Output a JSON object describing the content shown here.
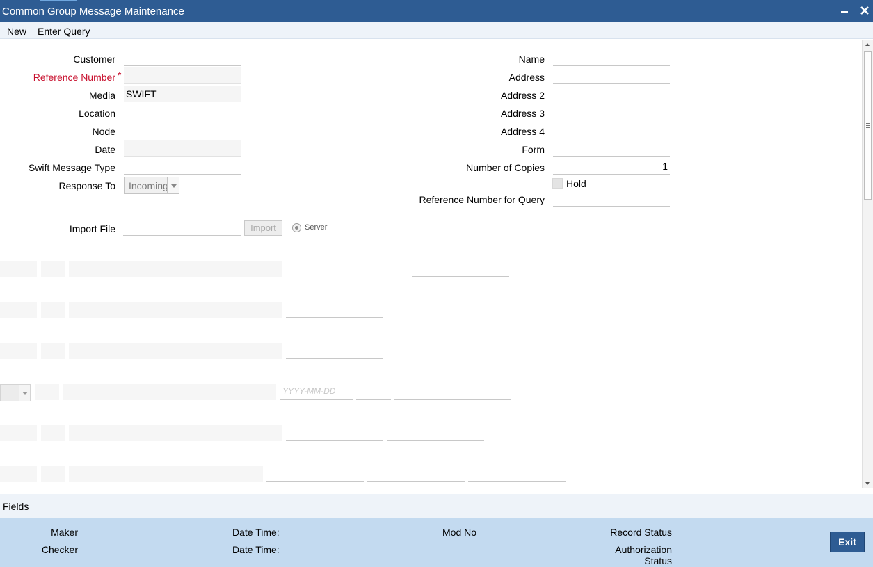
{
  "window": {
    "title": "Common Group Message Maintenance"
  },
  "menu": {
    "new_label": "New",
    "enter_query_label": "Enter Query"
  },
  "form": {
    "customer_label": "Customer",
    "customer_value": "",
    "reference_number_label": "Reference Number",
    "reference_number_required": "*",
    "reference_number_value": "",
    "media_label": "Media",
    "media_value": "SWIFT",
    "location_label": "Location",
    "location_value": "",
    "node_label": "Node",
    "node_value": "",
    "date_label": "Date",
    "date_value": "",
    "swift_message_type_label": "Swift Message Type",
    "swift_message_type_value": "",
    "response_to_label": "Response To",
    "response_to_value": "Incoming",
    "name_label": "Name",
    "name_value": "",
    "address_label": "Address",
    "address_value": "",
    "address2_label": "Address 2",
    "address2_value": "",
    "address3_label": "Address 3",
    "address3_value": "",
    "address4_label": "Address 4",
    "address4_value": "",
    "form_label": "Form",
    "form_value": "",
    "number_of_copies_label": "Number of Copies",
    "number_of_copies_value": "1",
    "hold_label": "Hold",
    "hold_checked": false,
    "reference_number_for_query_label": "Reference Number for Query",
    "reference_number_for_query_value": "",
    "import_file_label": "Import File",
    "import_file_value": "",
    "import_button_label": "Import",
    "server_option_label": "Server"
  },
  "ghost_rows": {
    "date_placeholder": "YYYY-MM-DD"
  },
  "fields_bar": {
    "fields_label": "Fields"
  },
  "footer": {
    "maker_label": "Maker",
    "checker_label": "Checker",
    "date_time_label_1": "Date Time:",
    "date_time_label_2": "Date Time:",
    "mod_no_label": "Mod No",
    "record_status_label": "Record Status",
    "authorization_status_label_line1": "Authorization",
    "authorization_status_label_line2": "Status",
    "exit_label": "Exit"
  },
  "colors": {
    "titlebar": "#2e5c93",
    "required": "#c8102e",
    "footer": "#c3daf0",
    "menubar": "#eef3f9"
  }
}
